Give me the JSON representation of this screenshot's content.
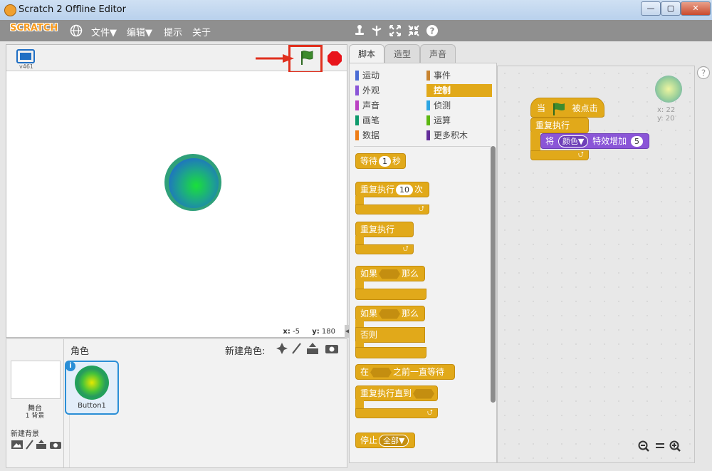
{
  "window": {
    "title": "Scratch 2 Offline Editor",
    "minimize": "—",
    "maximize": "▢",
    "close": "✕"
  },
  "menubar": {
    "logo": "SCRATCH",
    "items": [
      "文件▼",
      "编辑▼",
      "提示",
      "关于"
    ]
  },
  "stage": {
    "version": "v461",
    "x_label": "x:",
    "x_value": "-5",
    "y_label": "y:",
    "y_value": "180"
  },
  "sprite_pane": {
    "title": "角色",
    "new_sprite_label": "新建角色:",
    "stage_label": "舞台",
    "backdrop_count": "1 背景",
    "new_backdrop_label": "新建背景",
    "sprite_name": "Button1"
  },
  "tabs": [
    "脚本",
    "造型",
    "声音"
  ],
  "categories": [
    {
      "label": "运动",
      "color": "#4a6cd4"
    },
    {
      "label": "事件",
      "color": "#c88330"
    },
    {
      "label": "外观",
      "color": "#8a55d7"
    },
    {
      "label": "控制",
      "color": "#e1a91a"
    },
    {
      "label": "声音",
      "color": "#bb42c3"
    },
    {
      "label": "侦测",
      "color": "#2ca5e2"
    },
    {
      "label": "画笔",
      "color": "#0e9a6c"
    },
    {
      "label": "运算",
      "color": "#5cb712"
    },
    {
      "label": "数据",
      "color": "#ee7d16"
    },
    {
      "label": "更多积木",
      "color": "#632d99"
    }
  ],
  "blocks": {
    "wait_label": "等待",
    "wait_value": "1",
    "wait_unit": "秒",
    "repeat_label": "重复执行",
    "repeat_value": "10",
    "repeat_unit": "次",
    "forever_label": "重复执行",
    "if_label": "如果",
    "then_label": "那么",
    "else_label": "否则",
    "wait_until_pre": "在",
    "wait_until_post": "之前一直等待",
    "repeat_until_label": "重复执行直到",
    "stop_label": "停止",
    "stop_value": "全部▼"
  },
  "script": {
    "hat_pre": "当",
    "hat_post": "被点击",
    "forever_label": "重复执行",
    "effect_pre": "将",
    "effect_name": "颜色▼",
    "effect_post": "特效增加",
    "effect_value": "5",
    "sprite_x": "x: 22",
    "sprite_y": "y: 20"
  },
  "colors": {
    "control": "#e1a91a",
    "events": "#c88330",
    "looks": "#8a55d7",
    "highlight_box": "#e0301e",
    "stop_sign": "#e8141b",
    "flag": "#3d8b2e"
  },
  "icons": [
    "globe-icon",
    "duplicate-icon",
    "delete-icon",
    "grow-icon",
    "shrink-icon",
    "help-icon",
    "green-flag-icon",
    "stop-icon",
    "fullscreen-icon",
    "paint-icon",
    "brush-icon",
    "upload-icon",
    "camera-icon",
    "info-icon",
    "zoom-out-icon",
    "zoom-reset-icon",
    "zoom-in-icon"
  ]
}
